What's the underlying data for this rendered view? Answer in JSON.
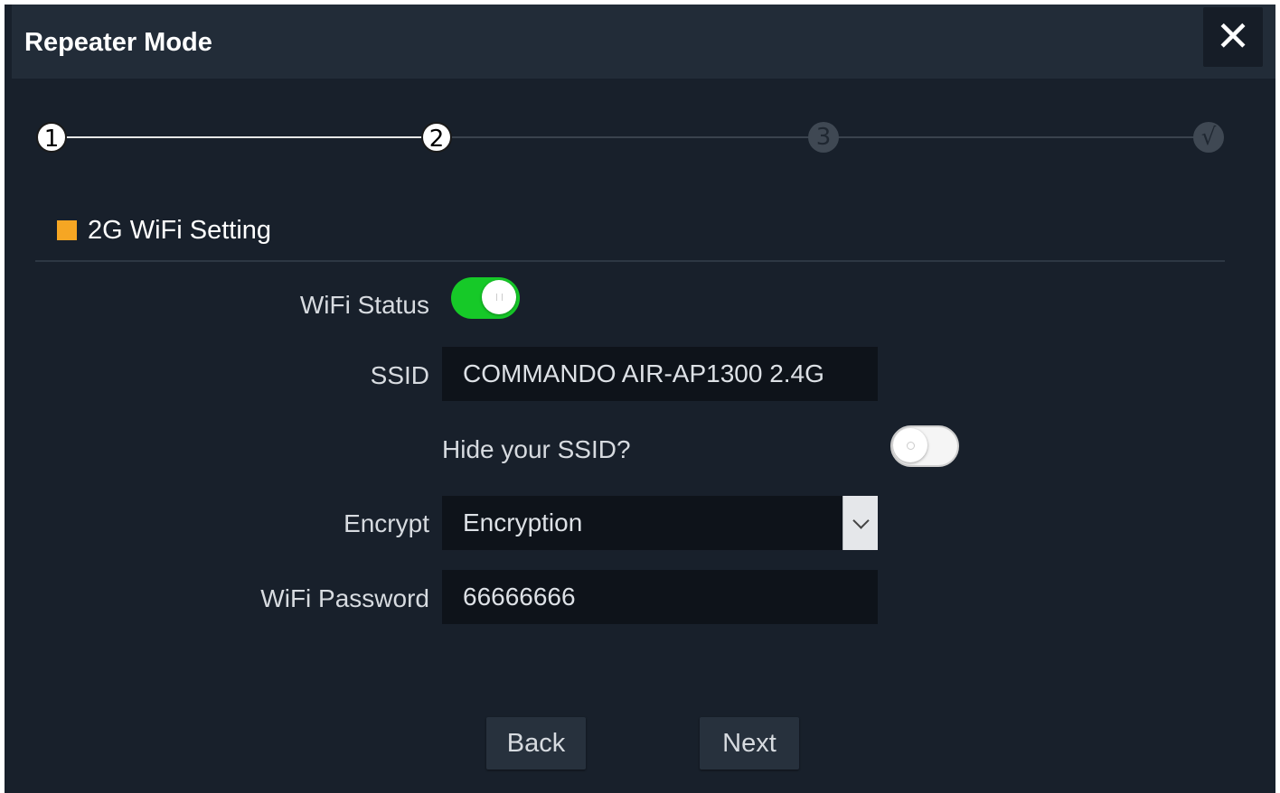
{
  "dialog": {
    "title": "Repeater Mode",
    "close_label": "✕"
  },
  "steps": [
    {
      "label": "1",
      "state": "active"
    },
    {
      "label": "2",
      "state": "active"
    },
    {
      "label": "3",
      "state": "inactive"
    },
    {
      "label": "√",
      "state": "inactive"
    }
  ],
  "section": {
    "title": "2G WiFi Setting",
    "accent_color": "#f6a623"
  },
  "form": {
    "wifi_status_label": "WiFi Status",
    "wifi_status_on": true,
    "ssid_label": "SSID",
    "ssid_value": "COMMANDO AIR-AP1300 2.4G",
    "hide_ssid_label": "Hide your SSID?",
    "hide_ssid_on": false,
    "encrypt_label": "Encrypt",
    "encrypt_value": "Encryption",
    "password_label": "WiFi Password",
    "password_value": "66666666"
  },
  "buttons": {
    "back": "Back",
    "next": "Next"
  },
  "colors": {
    "toggle_on": "#16c928",
    "background": "#18202b",
    "header": "#222c38"
  }
}
